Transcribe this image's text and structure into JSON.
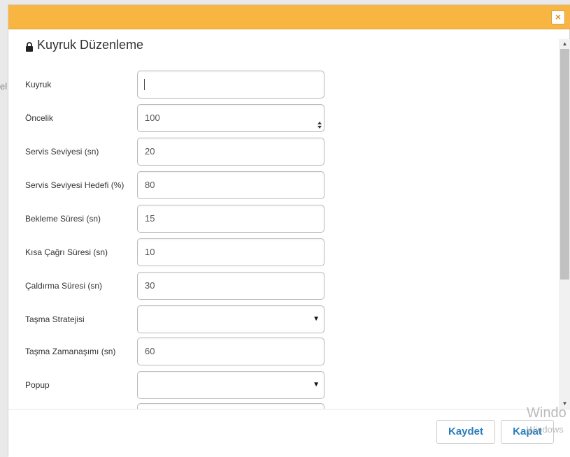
{
  "background": {
    "partial_text": "eli"
  },
  "modal": {
    "close_glyph": "×",
    "title": "Kuyruk Düzenleme",
    "header_color": "#f8b542",
    "fields": [
      {
        "label": "Kuyruk",
        "value": "",
        "type": "text"
      },
      {
        "label": "Öncelik",
        "value": "100",
        "type": "number"
      },
      {
        "label": "Servis Seviyesi (sn)",
        "value": "20",
        "type": "text"
      },
      {
        "label": "Servis Seviyesi Hedefi (%)",
        "value": "80",
        "type": "text"
      },
      {
        "label": "Bekleme Süresi (sn)",
        "value": "15",
        "type": "text"
      },
      {
        "label": "Kısa Çağrı Süresi (sn)",
        "value": "10",
        "type": "text"
      },
      {
        "label": "Çaldırma Süresi (sn)",
        "value": "30",
        "type": "text"
      },
      {
        "label": "Taşma Stratejisi",
        "value": "",
        "type": "select"
      },
      {
        "label": "Taşma Zamanaşımı (sn)",
        "value": "60",
        "type": "text"
      },
      {
        "label": "Popup",
        "value": "",
        "type": "select"
      }
    ]
  },
  "footer": {
    "save_label": "Kaydet",
    "close_label": "Kapat",
    "button_color": "#2b7dbc"
  },
  "watermark": {
    "line1": "Windo",
    "line2": "Windows"
  }
}
